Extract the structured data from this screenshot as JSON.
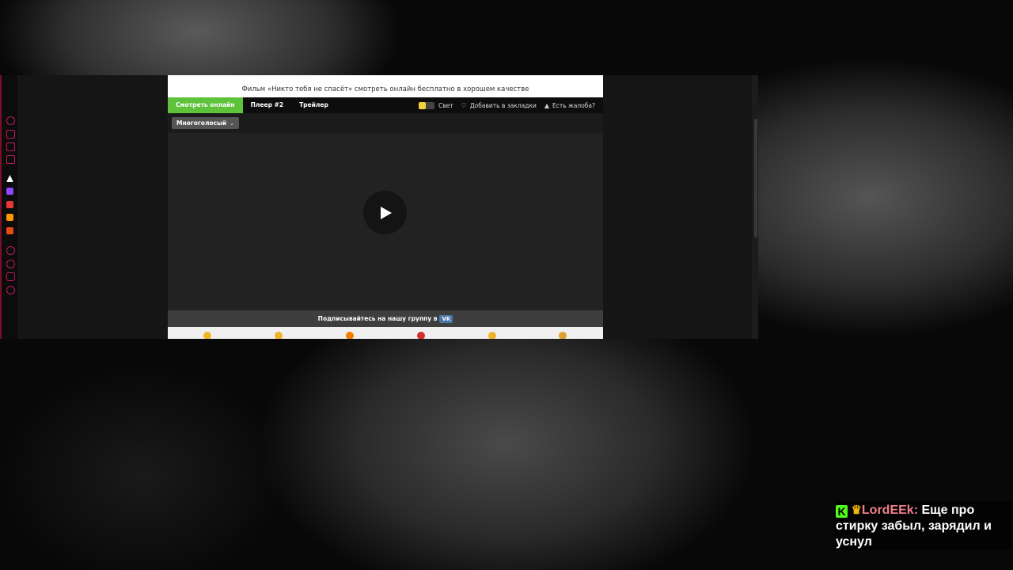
{
  "site": {
    "title": "Фильм «Никто тебя не спасёт» смотреть онлайн бесплатно в хорошем качестве",
    "tabs": [
      {
        "label": "Смотреть онлайн",
        "active": true
      },
      {
        "label": "Плеер #2",
        "active": false
      },
      {
        "label": "Трейлер",
        "active": false
      }
    ],
    "tools": {
      "light_label": "Свет",
      "bookmark_label": "Добавить в закладки",
      "complaint_label": "Есть жалоба?"
    },
    "voice_select": {
      "selected": "Многоголосый"
    },
    "subscribe": {
      "text": "Подписывайтесь на нашу группу в",
      "vk_label": "VK"
    },
    "colors": {
      "accent": "#5ec23a",
      "vk": "#4a76a8"
    }
  },
  "sidebar": {
    "icons": [
      "history-icon",
      "home-icon",
      "calendar-icon",
      "notes-icon",
      "app-icon",
      "twitch-icon",
      "extension-icon",
      "store-icon",
      "game-icon",
      "play-icon",
      "clock-icon",
      "chat-icon",
      "settings-icon"
    ]
  },
  "chat": {
    "username": "LordEEk:",
    "message": "Еще про стирку забыл, зарядил и уснул",
    "badge_k": "K"
  }
}
